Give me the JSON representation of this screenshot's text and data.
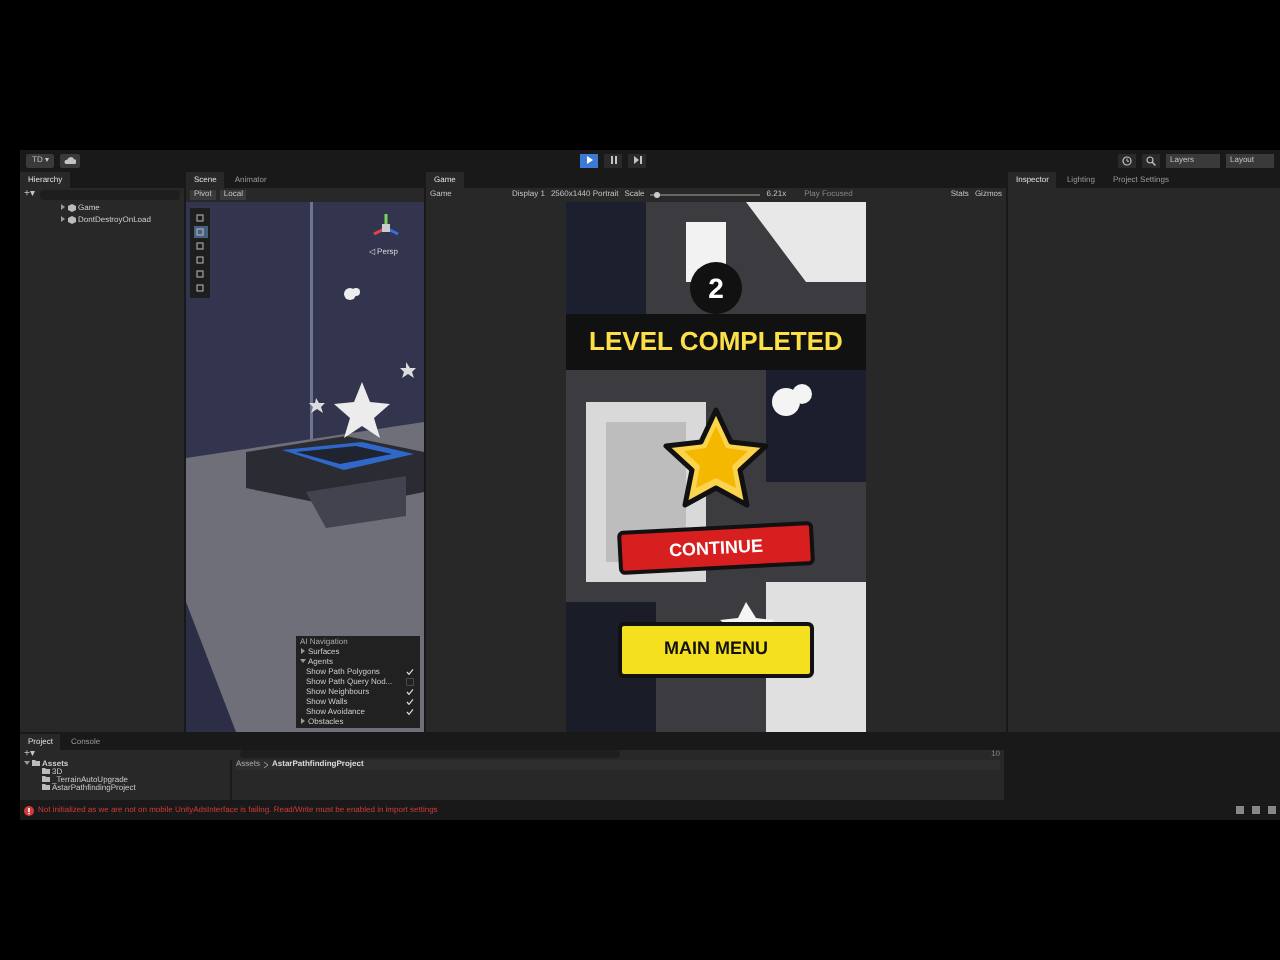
{
  "toolbar": {
    "account": "TD ▾",
    "layers": "Layers",
    "layout": "Layout"
  },
  "panels": {
    "hierarchy": {
      "tabs": [
        {
          "label": "Hierarchy",
          "selected": true
        }
      ],
      "add": "+▾",
      "items": [
        {
          "label": "Game",
          "expanded": false
        },
        {
          "label": "DontDestroyOnLoad",
          "expanded": false
        }
      ]
    },
    "scene": {
      "tabs": [
        {
          "label": "Scene",
          "selected": true
        },
        {
          "label": "Animator",
          "selected": false
        }
      ],
      "pivot": "Pivot",
      "local": "Local",
      "persp": "◁ Persp",
      "ai_navigation": {
        "title": "AI Navigation",
        "sections": [
          {
            "label": "Surfaces",
            "expanded": false
          },
          {
            "label": "Agents",
            "expanded": true,
            "options": [
              {
                "label": "Show Path Polygons",
                "checked": true
              },
              {
                "label": "Show Path Query Nod...",
                "checked": false
              },
              {
                "label": "Show Neighbours",
                "checked": true
              },
              {
                "label": "Show Walls",
                "checked": true
              },
              {
                "label": "Show Avoidance",
                "checked": true
              }
            ]
          },
          {
            "label": "Obstacles",
            "expanded": false
          }
        ]
      }
    },
    "game": {
      "tabs": [
        {
          "label": "Game",
          "selected": true
        }
      ],
      "mode": "Game",
      "display": "Display 1",
      "resolution": "2560x1440 Portrait",
      "scale_label": "Scale",
      "scale": "6.21x",
      "scale_slider": {
        "level": 0.05
      },
      "play_mode": "Play Focused",
      "stats": "Stats",
      "gizmos": "Gizmos",
      "screen": {
        "level": "2",
        "banner": "LEVEL COMPLETED",
        "continue": "CONTINUE",
        "main_menu": "MAIN MENU"
      }
    },
    "inspector": {
      "tabs": [
        {
          "label": "Inspector",
          "selected": true
        },
        {
          "label": "Lighting",
          "selected": false
        },
        {
          "label": "Project Settings",
          "selected": false
        }
      ]
    },
    "project": {
      "tabs": [
        {
          "label": "Project",
          "selected": true
        },
        {
          "label": "Console",
          "selected": false
        }
      ],
      "add": "+▾",
      "tree": [
        {
          "label": "Assets",
          "expanded": true,
          "children": [
            {
              "label": "3D"
            },
            {
              "label": "_TerrainAutoUpgrade"
            },
            {
              "label": "AstarPathfindingProject"
            }
          ]
        }
      ],
      "breadcrumb": [
        "Assets",
        "AstarPathfindingProject"
      ],
      "count": "10"
    }
  },
  "status_bar": {
    "message": "Not initialized as we are not on mobile  UnityAdsInterface is failing. Read/Write must be enabled in import settings"
  }
}
